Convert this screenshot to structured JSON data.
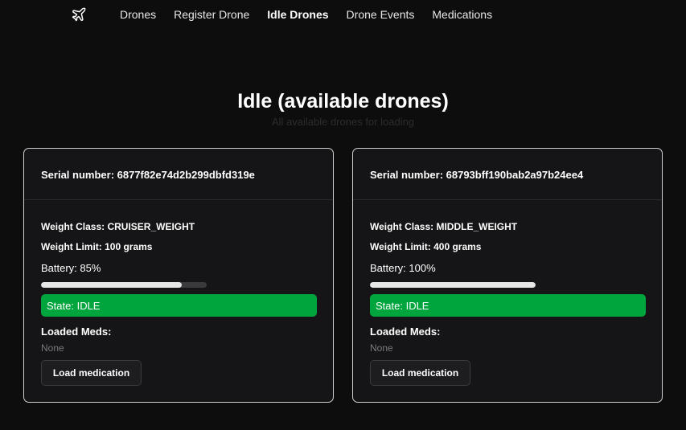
{
  "nav": {
    "logo_icon": "airplane-icon",
    "links": [
      {
        "label": "Drones",
        "active": false
      },
      {
        "label": "Register Drone",
        "active": false
      },
      {
        "label": "Idle Drones",
        "active": true
      },
      {
        "label": "Drone Events",
        "active": false
      },
      {
        "label": "Medications",
        "active": false
      }
    ]
  },
  "page": {
    "title": "Idle (available drones)",
    "subtitle": "All available drones for loading"
  },
  "colors": {
    "background": "#0d0d0d",
    "card": "#151517",
    "state_idle": "#00a53d",
    "battery_fill": "#e6e6e6"
  },
  "drones": [
    {
      "serial_text": "Serial number: 6877f82e74d2b299dbfd319e",
      "weight_class_text": "Weight Class: CRUISER_WEIGHT",
      "weight_limit_text": "Weight Limit: 100 grams",
      "battery_text": "Battery: 85%",
      "battery_percent": 85,
      "state_text": "State: IDLE",
      "loaded_meds_label": "Loaded Meds:",
      "loaded_meds_value": "None",
      "load_button_label": "Load medication"
    },
    {
      "serial_text": "Serial number: 68793bff190bab2a97b24ee4",
      "weight_class_text": "Weight Class: MIDDLE_WEIGHT",
      "weight_limit_text": "Weight Limit: 400 grams",
      "battery_text": "Battery: 100%",
      "battery_percent": 100,
      "state_text": "State: IDLE",
      "loaded_meds_label": "Loaded Meds:",
      "loaded_meds_value": "None",
      "load_button_label": "Load medication"
    }
  ]
}
